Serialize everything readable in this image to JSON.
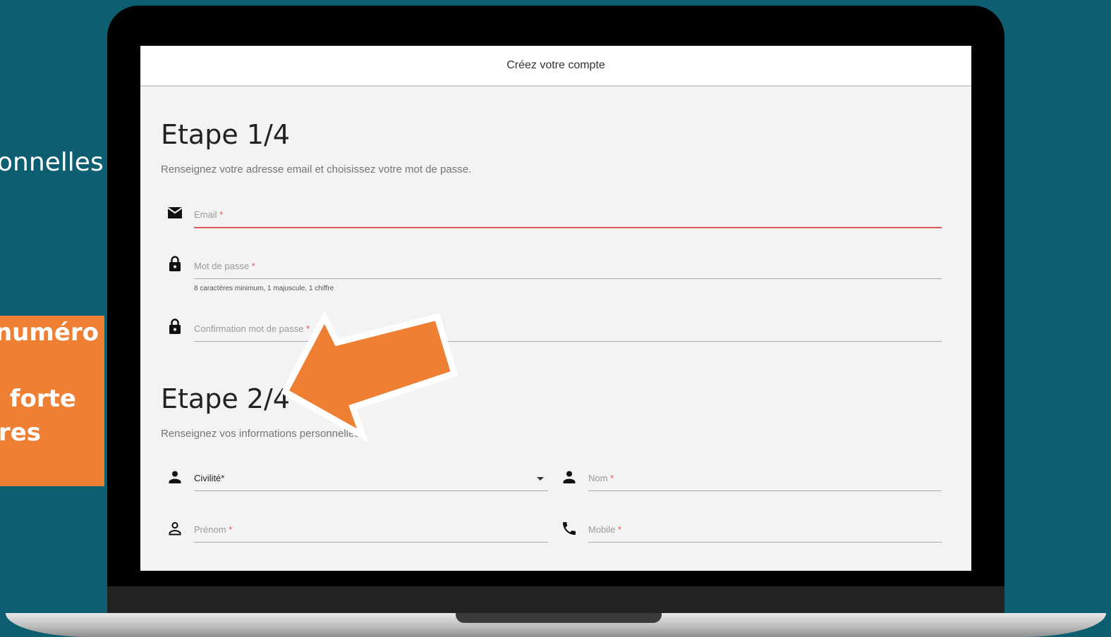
{
  "side": {
    "partial_text": "onnelles :",
    "orange_lines": [
      "e numéro",
      "on forte",
      "ures"
    ]
  },
  "app": {
    "header_title": "Créez votre compte"
  },
  "step1": {
    "title": "Etape 1/4",
    "subtitle": "Renseignez votre adresse email et choisissez votre mot de passe.",
    "email_label": "Email",
    "password_label": "Mot de passe",
    "password_hint": "8 caractères minimum, 1 majuscule, 1 chiffre",
    "confirm_label": "Confirmation mot de passe"
  },
  "step2": {
    "title": "Etape 2/4",
    "subtitle": "Renseignez vos informations personnelles.",
    "civility_value": "Civilité*",
    "nom_label": "Nom",
    "prenom_label": "Prénom",
    "mobile_label": "Mobile"
  },
  "required_marker": "*",
  "colors": {
    "background": "#0e5e72",
    "accent_orange": "#ee7f33",
    "error_red": "#e05656"
  },
  "icons": [
    "mail-icon",
    "lock-icon",
    "person-icon",
    "person-outline-icon",
    "phone-icon",
    "chevron-down-icon",
    "arrow-icon"
  ]
}
